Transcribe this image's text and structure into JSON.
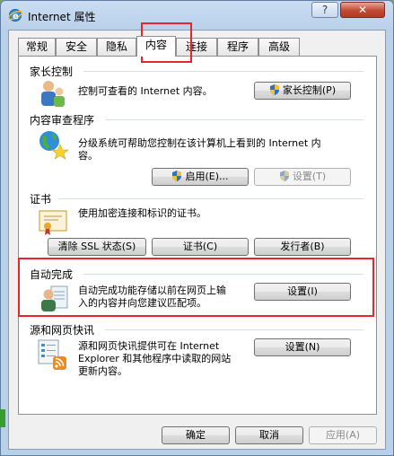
{
  "window": {
    "title": "Internet 属性",
    "help_label": "?",
    "close_label": "✕"
  },
  "tabs": [
    "常规",
    "安全",
    "隐私",
    "内容",
    "连接",
    "程序",
    "高级"
  ],
  "active_tab": "内容",
  "sections": {
    "parental": {
      "title": "家长控制",
      "text": "控制可查看的 Internet 内容。",
      "button": "家长控制(P)"
    },
    "advisor": {
      "title": "内容审查程序",
      "text_line1": "分级系统可帮助您控制在该计算机上看到的 Internet 内",
      "text_line2": "容。",
      "enable_button": "启用(E)...",
      "settings_button": "设置(T)"
    },
    "certificates": {
      "title": "证书",
      "text": "使用加密连接和标识的证书。",
      "clear_ssl_button": "清除 SSL 状态(S)",
      "certificates_button": "证书(C)",
      "publishers_button": "发行者(B)"
    },
    "autocomplete": {
      "title": "自动完成",
      "text_line1": "自动完成功能存储以前在网页上输",
      "text_line2": "入的内容并向您建议匹配项。",
      "settings_button": "设置(I)"
    },
    "feeds": {
      "title": "源和网页快讯",
      "text_line1": "源和网页快讯提供可在 Internet",
      "text_line2": "Explorer 和其他程序中读取的网站",
      "text_line3": "更新内容。",
      "settings_button": "设置(N)"
    }
  },
  "footer": {
    "ok": "确定",
    "cancel": "取消",
    "apply": "应用(A)"
  },
  "highlight_color": "#e8252c"
}
